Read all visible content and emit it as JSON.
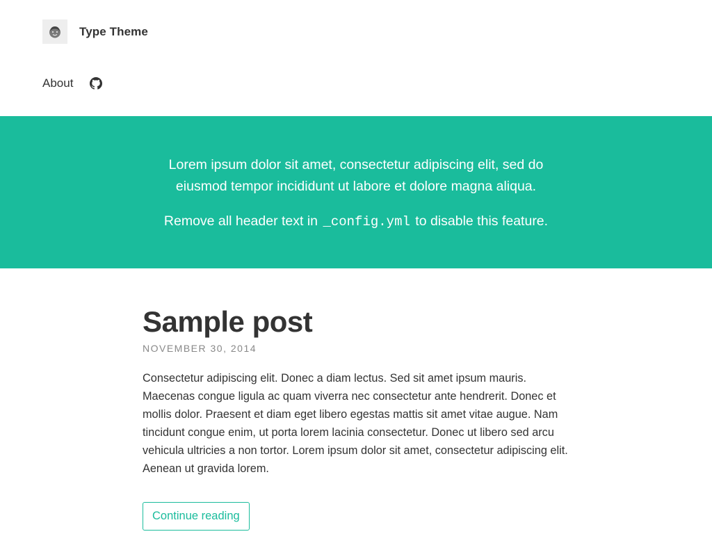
{
  "header": {
    "site_title": "Type Theme",
    "avatar_icon": "avatar-face-icon",
    "nav": {
      "about_label": "About",
      "github_icon": "github-icon"
    }
  },
  "hero": {
    "lead": "Lorem ipsum dolor sit amet, consectetur adipiscing elit, sed do eiusmod tempor incididunt ut labore et dolore magna aliqua.",
    "note_before": "Remove all header text in ",
    "note_code": "_config.yml",
    "note_after": " to disable this feature."
  },
  "post": {
    "title": "Sample post",
    "date": "NOVEMBER 30, 2014",
    "excerpt": "Consectetur adipiscing elit. Donec a diam lectus. Sed sit amet ipsum mauris. Maecenas congue ligula ac quam viverra nec consectetur ante hendrerit. Donec et mollis dolor. Praesent et diam eget libero egestas mattis sit amet vitae augue. Nam tincidunt congue enim, ut porta lorem lacinia consectetur. Donec ut libero sed arcu vehicula ultricies a non tortor. Lorem ipsum dolor sit amet, consectetur adipiscing elit. Aenean ut gravida lorem.",
    "read_more_label": "Continue reading"
  },
  "colors": {
    "accent": "#1abc9c",
    "text": "#333333",
    "muted": "#888888"
  }
}
